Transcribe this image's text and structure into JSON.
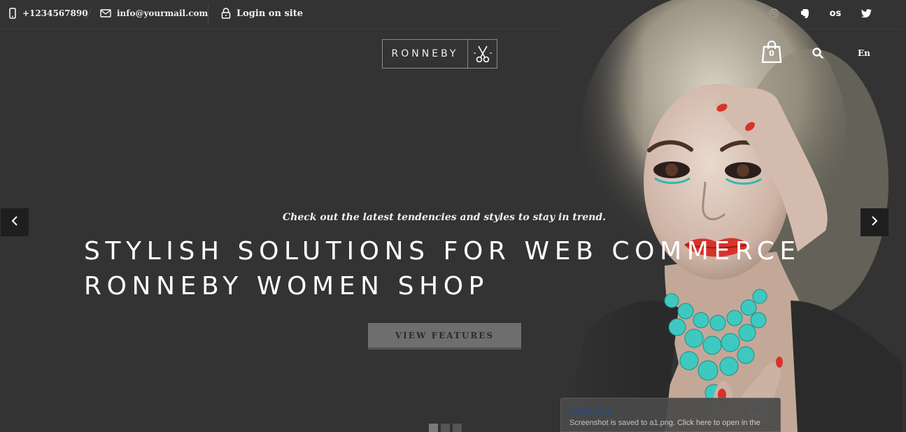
{
  "topbar": {
    "phone": "+1234567890",
    "email": "info@yourmail.com",
    "login": "Login on site",
    "social": [
      "dribbble-icon",
      "evernote-icon",
      "lastfm-icon",
      "twitter-icon"
    ],
    "lastfm_glyph": "os"
  },
  "header": {
    "logo_text": "RONNEBY",
    "cart_count": "0",
    "language": "En"
  },
  "hero": {
    "tagline": "Check out the latest tendencies and styles to stay in trend.",
    "headline_line1": "STYLISH SOLUTIONS FOR WEB COMMERCE",
    "headline_line2": "RONNEBY WOMEN SHOP",
    "cta_label": "VIEW FEATURES",
    "slides": 3,
    "active_slide": 1
  },
  "toast": {
    "title": "Lightshot",
    "message": "Screenshot is saved to a1.png. Click here to open in the"
  },
  "colors": {
    "background": "#333333",
    "button": "#6e6e6e",
    "accent_turquoise": "#3ec9c0",
    "lips": "#d8322b"
  }
}
